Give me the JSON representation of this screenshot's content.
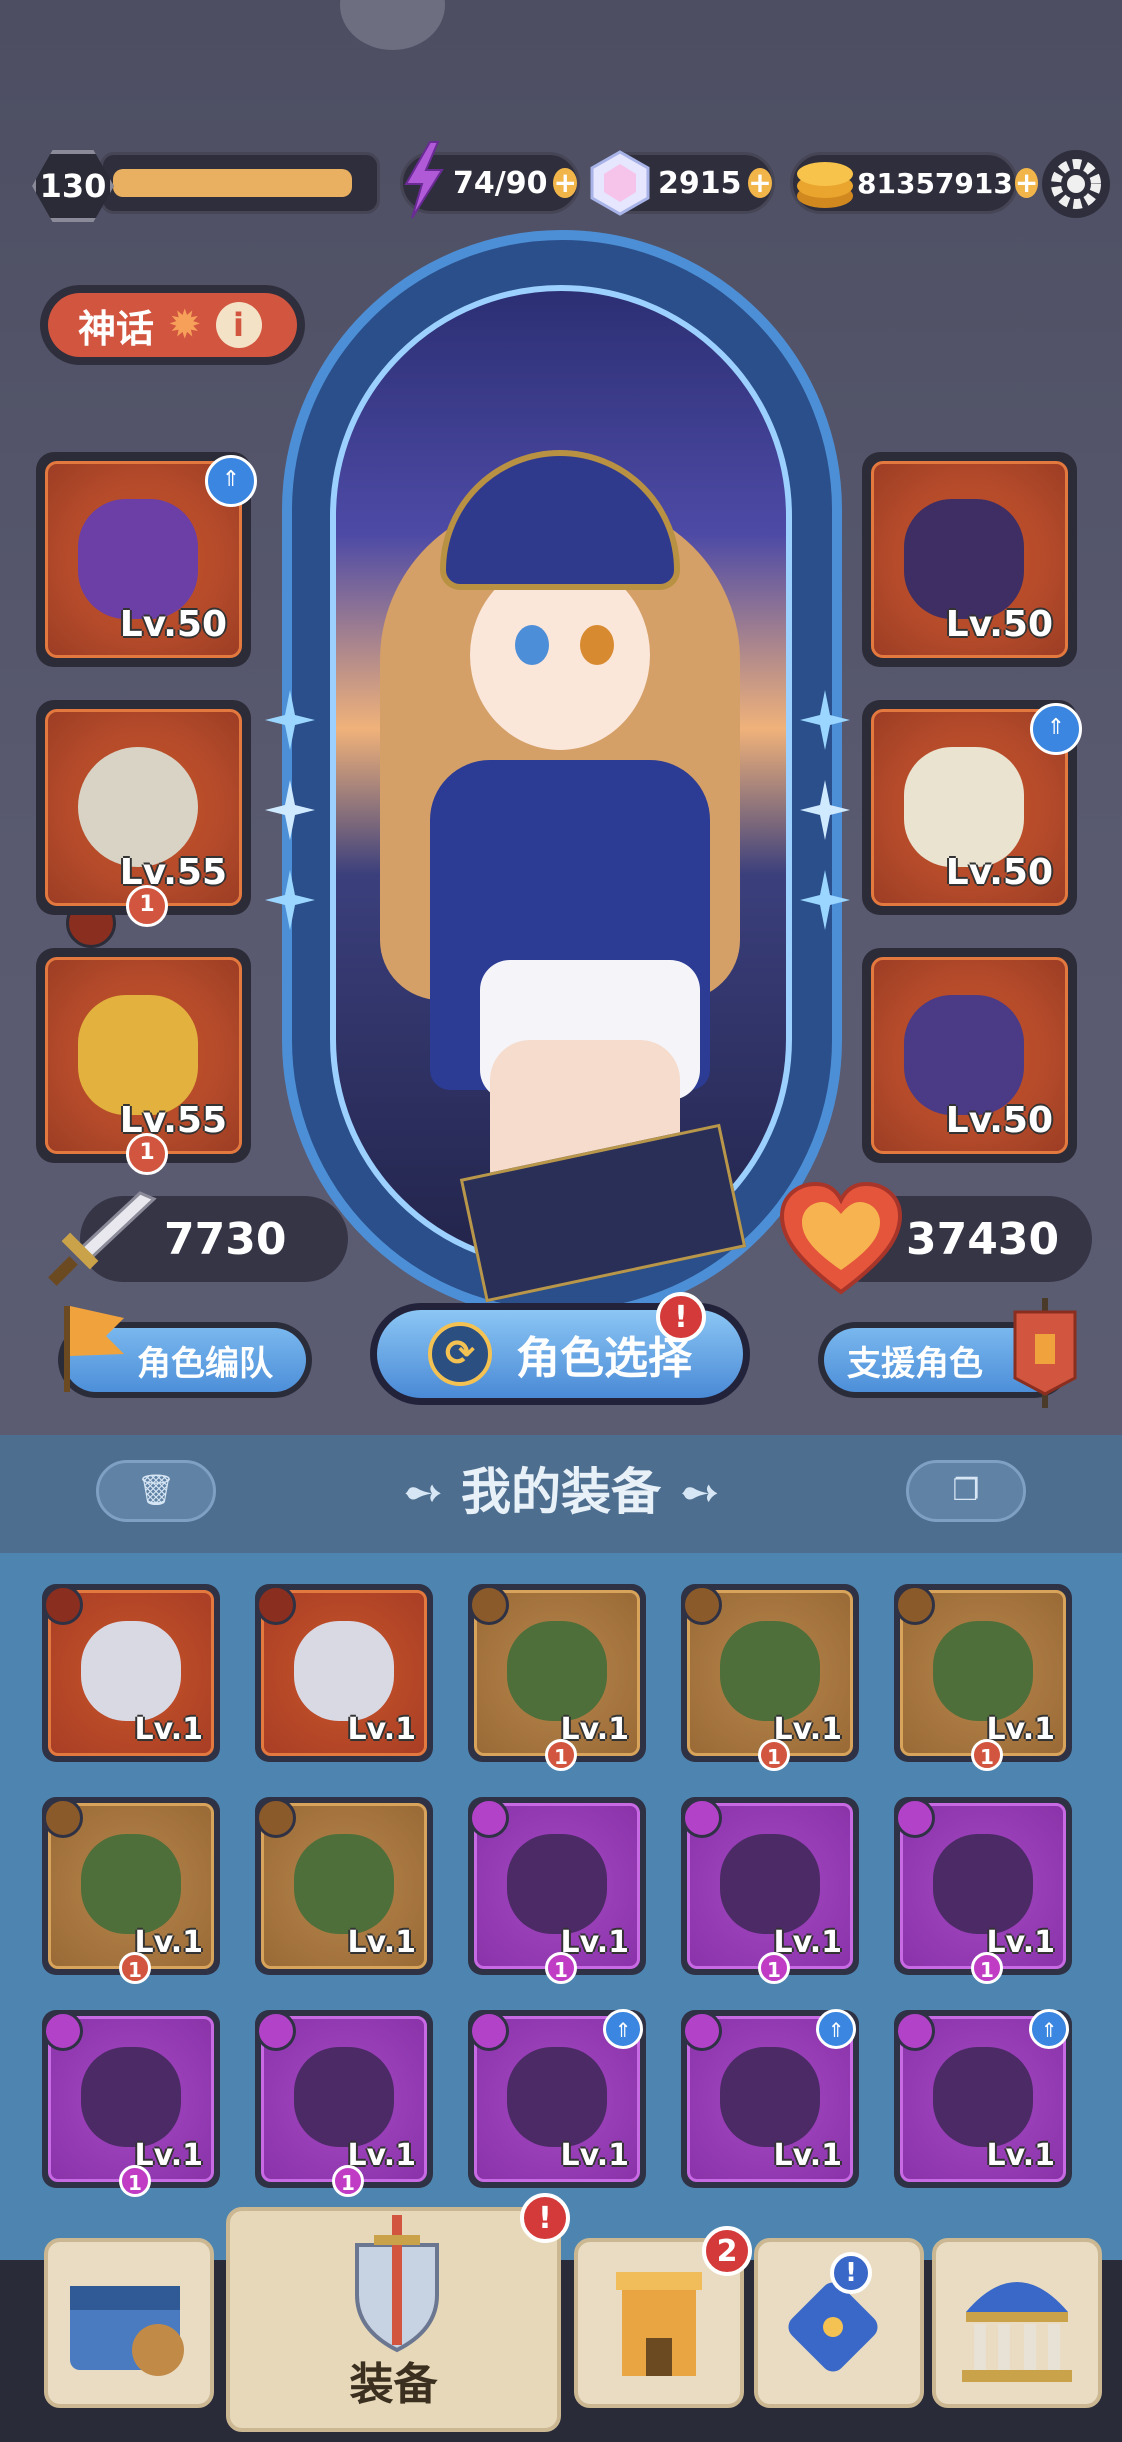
{
  "status_bar": {
    "level": "130",
    "xp_fraction": 0.92,
    "energy": "74/90",
    "gems": "2915",
    "gold": "81357913"
  },
  "rarity": {
    "label": "神话",
    "info_symbol": "i"
  },
  "equipped": {
    "left": [
      {
        "icon": "weapon-staff-icon",
        "level": "Lv.50",
        "count": "",
        "upgrade": true
      },
      {
        "icon": "ring-icon",
        "level": "Lv.55",
        "count": "1",
        "upgrade": false
      },
      {
        "icon": "bracer-icon",
        "level": "Lv.55",
        "count": "1",
        "upgrade": false
      }
    ],
    "right": [
      {
        "icon": "helmet-icon",
        "level": "Lv.50",
        "count": "",
        "upgrade": false
      },
      {
        "icon": "armor-icon",
        "level": "Lv.50",
        "count": "",
        "upgrade": true
      },
      {
        "icon": "boots-icon",
        "level": "Lv.50",
        "count": "",
        "upgrade": false
      }
    ]
  },
  "stats": {
    "attack": "7730",
    "hp": "37430"
  },
  "buttons": {
    "team": "角色编队",
    "select": "角色选择",
    "select_alert": "!",
    "support": "支援角色"
  },
  "inventory": {
    "title": "我的装备",
    "rows": [
      [
        {
          "rarity": "red",
          "level": "Lv.1",
          "count": "",
          "upgrade": false,
          "icon": "sword-icon"
        },
        {
          "rarity": "red",
          "level": "Lv.1",
          "count": "",
          "upgrade": false,
          "icon": "armor-icon"
        },
        {
          "rarity": "gold",
          "level": "Lv.1",
          "count": "1",
          "upgrade": false,
          "icon": "hat-icon"
        },
        {
          "rarity": "gold",
          "level": "Lv.1",
          "count": "1",
          "upgrade": false,
          "icon": "hood-icon"
        },
        {
          "rarity": "gold",
          "level": "Lv.1",
          "count": "1",
          "upgrade": false,
          "icon": "boots-icon"
        }
      ],
      [
        {
          "rarity": "gold",
          "level": "Lv.1",
          "count": "1",
          "upgrade": false,
          "icon": "boots-icon"
        },
        {
          "rarity": "gold",
          "level": "Lv.1",
          "count": "",
          "upgrade": false,
          "icon": "boots-icon"
        },
        {
          "rarity": "purple",
          "level": "Lv.1",
          "count": "1",
          "upgrade": false,
          "icon": "ring-icon"
        },
        {
          "rarity": "purple",
          "level": "Lv.1",
          "count": "1",
          "upgrade": false,
          "icon": "amulet-icon"
        },
        {
          "rarity": "purple",
          "level": "Lv.1",
          "count": "1",
          "upgrade": false,
          "icon": "hat-icon"
        }
      ],
      [
        {
          "rarity": "purple",
          "level": "Lv.1",
          "count": "1",
          "upgrade": false,
          "icon": "hat-icon"
        },
        {
          "rarity": "purple",
          "level": "Lv.1",
          "count": "1",
          "upgrade": false,
          "icon": "boots-icon"
        },
        {
          "rarity": "purple",
          "level": "Lv.1",
          "count": "",
          "upgrade": true,
          "icon": "ring-icon"
        },
        {
          "rarity": "purple",
          "level": "Lv.1",
          "count": "",
          "upgrade": true,
          "icon": "ring-icon"
        },
        {
          "rarity": "purple",
          "level": "Lv.1",
          "count": "",
          "upgrade": true,
          "icon": "ring-icon"
        }
      ]
    ]
  },
  "nav": {
    "active_label": "装备",
    "active_alert": "!",
    "heroes_badge": "2",
    "dice_badge": "!"
  },
  "colors": {
    "red_rarity": "#c9552a",
    "gold_rarity": "#b7864d",
    "purple_rarity": "#a448c3",
    "accent_blue": "#4d8fd9"
  }
}
